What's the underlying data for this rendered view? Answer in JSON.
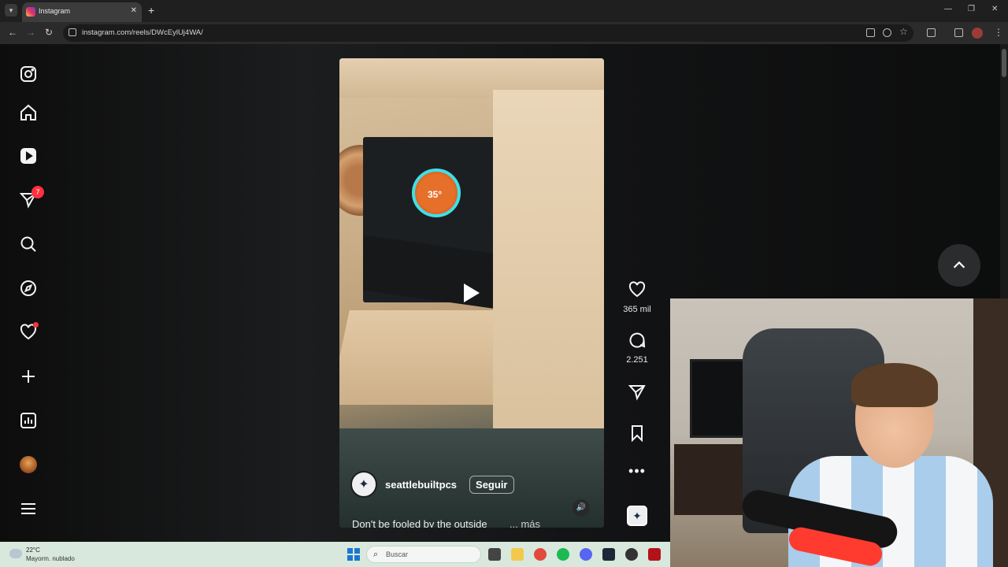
{
  "browser": {
    "tab_title": "Instagram",
    "url": "instagram.com/reels/DWcEylUj4WA/",
    "new_tab_label": "+",
    "close_label": "✕"
  },
  "sidebar": {
    "notifications_badge": "7"
  },
  "reel": {
    "overlay_temp": "35°",
    "username": "seattlebuiltpcs",
    "follow_label": "Seguir",
    "caption": "Don't be fooled by the outside",
    "more_label": "... más",
    "likes": "365 mil",
    "comments": "2.251"
  },
  "taskbar": {
    "temperature": "22°C",
    "weather": "Mayorm. nublado",
    "search_placeholder": "Buscar"
  },
  "colors": {
    "notification": "#ff3040",
    "accent_ring": "#3fe0e8",
    "windows_blue": "#1b77d2"
  }
}
